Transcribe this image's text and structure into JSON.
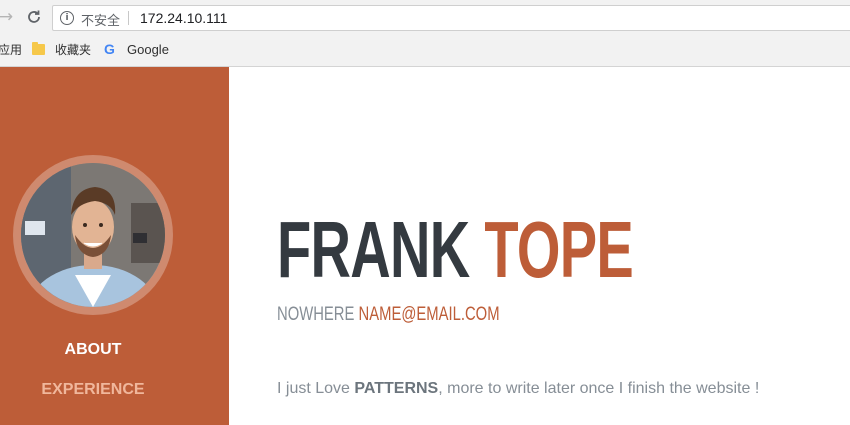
{
  "browser": {
    "back_icon": "→",
    "reload_icon": "C",
    "security_icon": "i",
    "security_label": "不安全",
    "url": "172.24.10.111",
    "bookmarks": {
      "apps_label": "应用",
      "favorites_label": "收藏夹",
      "google_label": "Google",
      "google_icon": "G"
    }
  },
  "sidebar": {
    "nav": [
      {
        "label": "ABOUT"
      },
      {
        "label": "EXPERIENCE"
      }
    ]
  },
  "profile": {
    "first_name": "FRANK",
    "last_name": "TOPE",
    "address": "NOWHERE",
    "email": "NAME@EMAIL.COM",
    "intro_before": "I just Love ",
    "intro_bold": "PATTERNS",
    "intro_after": ", more to write later once I finish the website !"
  },
  "colors": {
    "accent": "#bd5d38",
    "heading": "#343a40",
    "muted": "#868e96"
  }
}
